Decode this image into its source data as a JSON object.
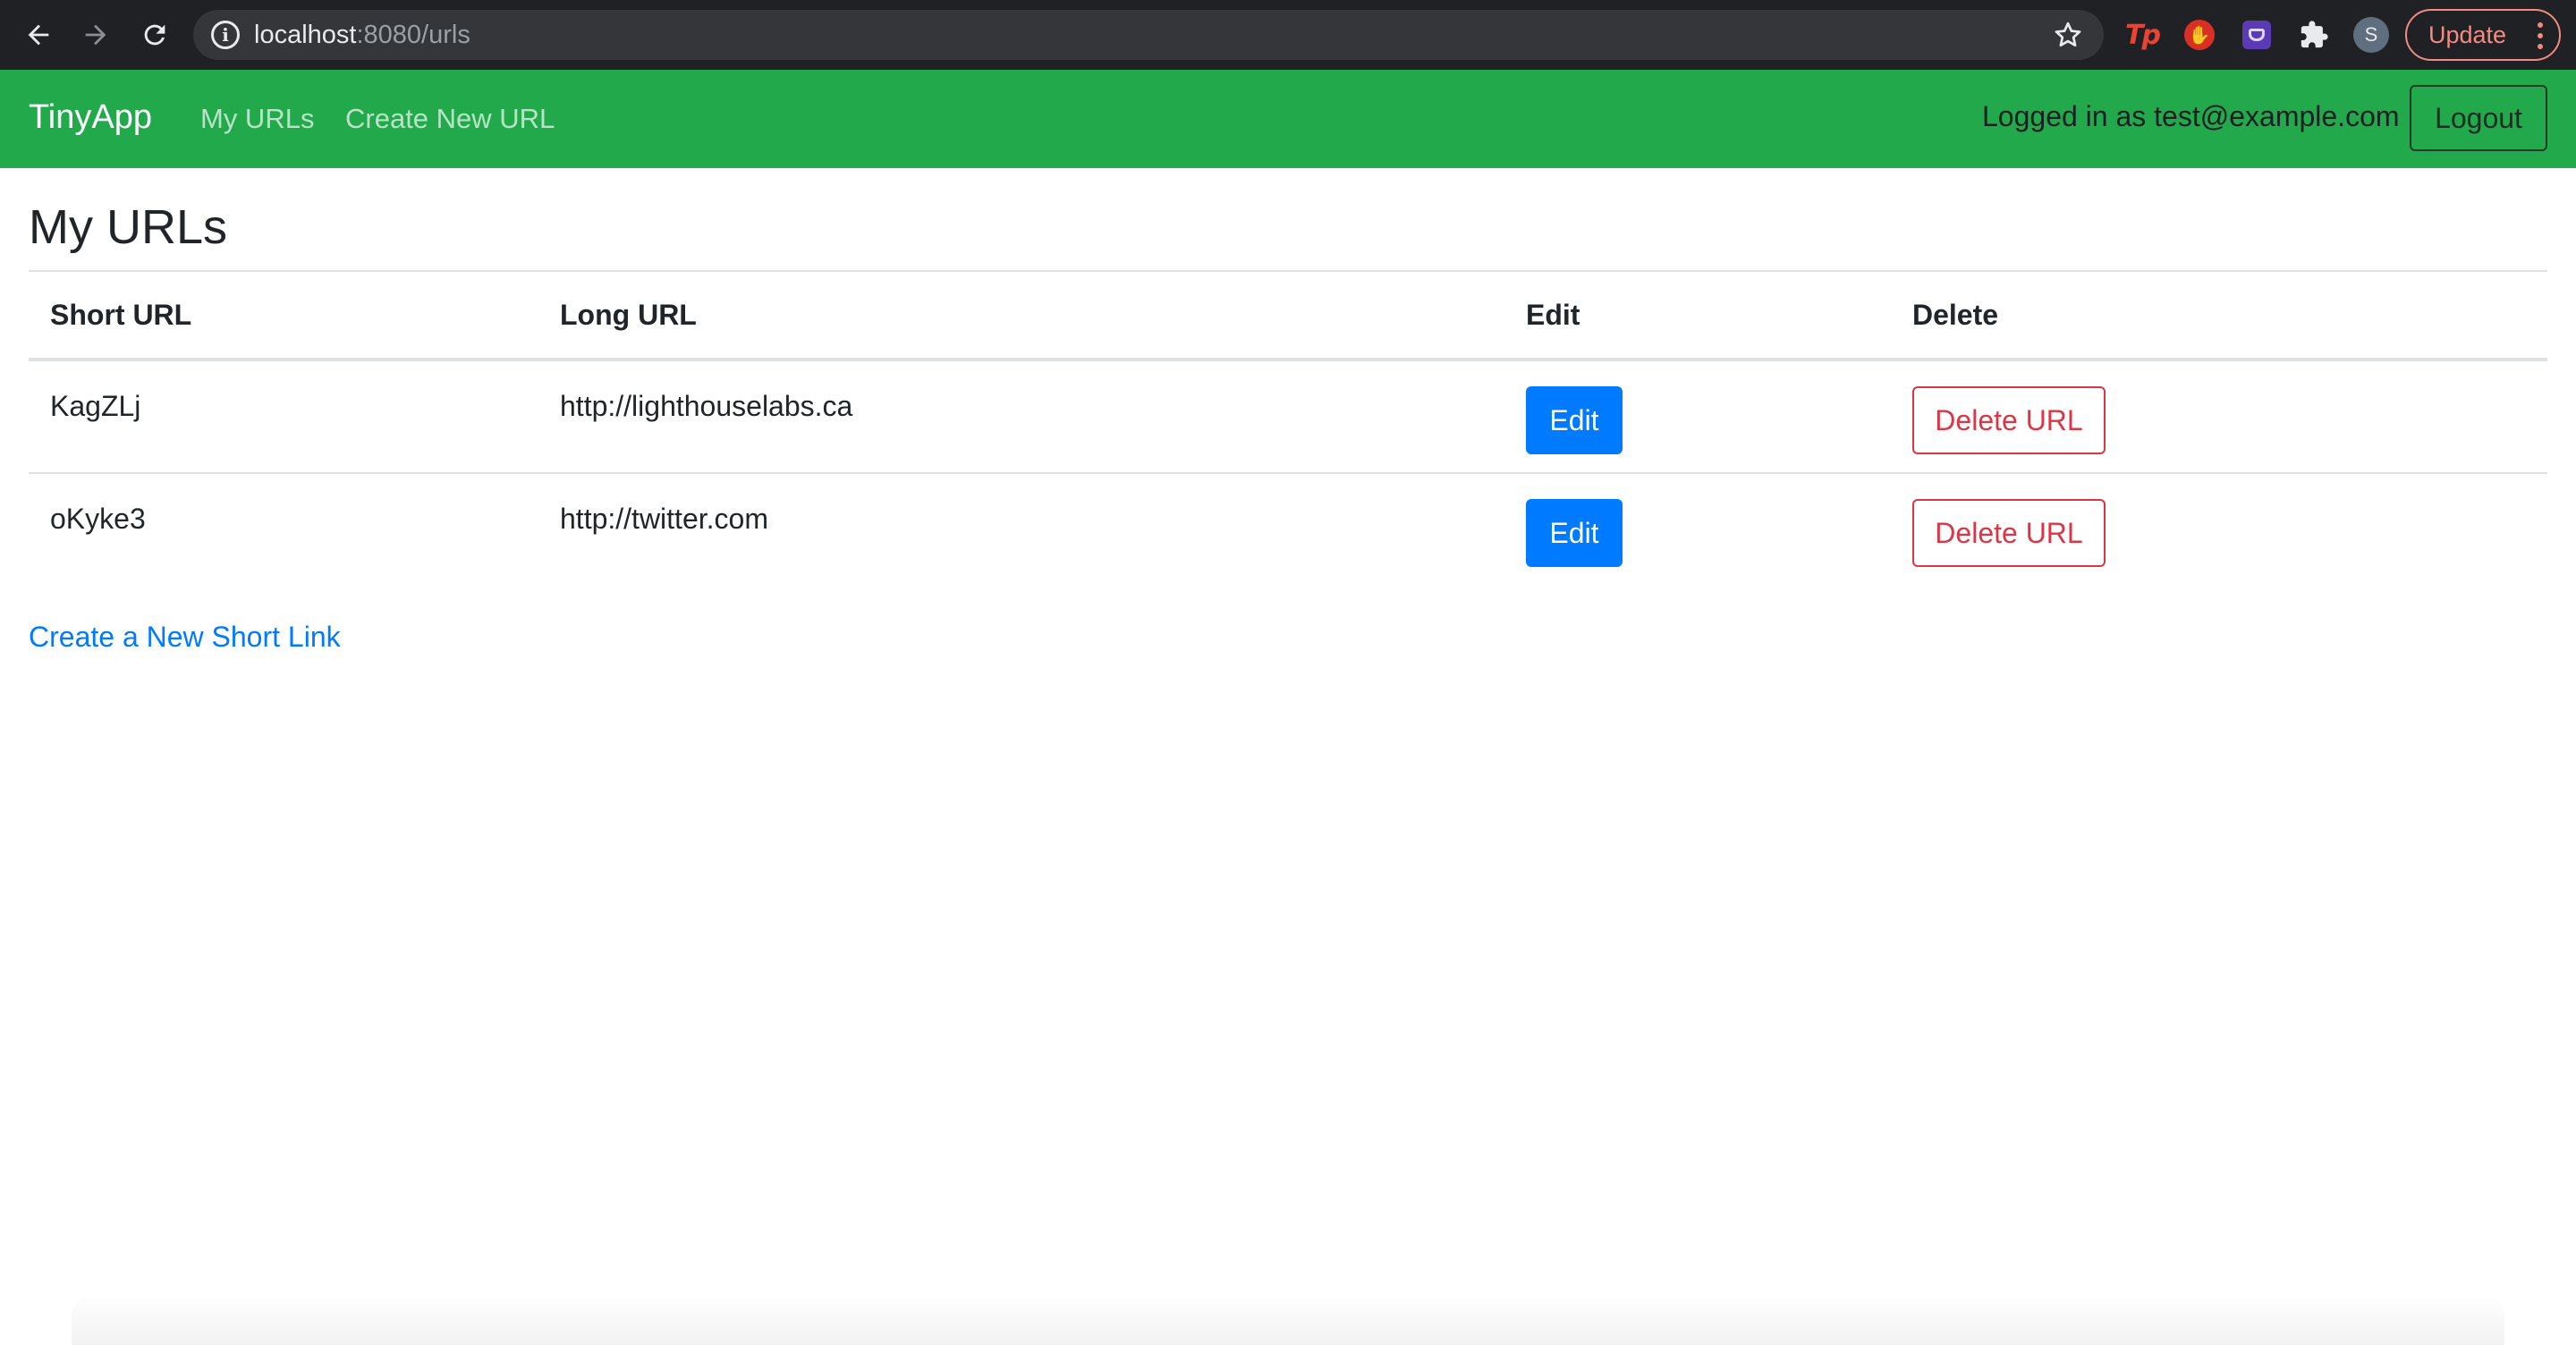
{
  "browser": {
    "url_host": "localhost",
    "url_path": ":8080/urls",
    "profile_initial": "S",
    "update_label": "Update",
    "extensions": [
      "tp-extension-icon",
      "hand-extension-icon",
      "purple-extension-icon",
      "puzzle-extensions-icon"
    ],
    "tp_label": "Tp"
  },
  "navbar": {
    "brand": "TinyApp",
    "links": [
      "My URLs",
      "Create New URL"
    ],
    "logged_in_text": "Logged in as test@example.com",
    "logout_label": "Logout",
    "color": "#22a94b"
  },
  "page": {
    "title": "My URLs",
    "table": {
      "headers": [
        "Short URL",
        "Long URL",
        "Edit",
        "Delete"
      ],
      "rows": [
        {
          "short": "KagZLj",
          "long": "http://lighthouselabs.ca",
          "edit": "Edit",
          "delete": "Delete URL"
        },
        {
          "short": "oKyke3",
          "long": "http://twitter.com",
          "edit": "Edit",
          "delete": "Delete URL"
        }
      ]
    },
    "create_link": "Create a New Short Link"
  },
  "colors": {
    "primary": "#007bff",
    "danger": "#dc3545",
    "chrome_bg": "#202124"
  }
}
